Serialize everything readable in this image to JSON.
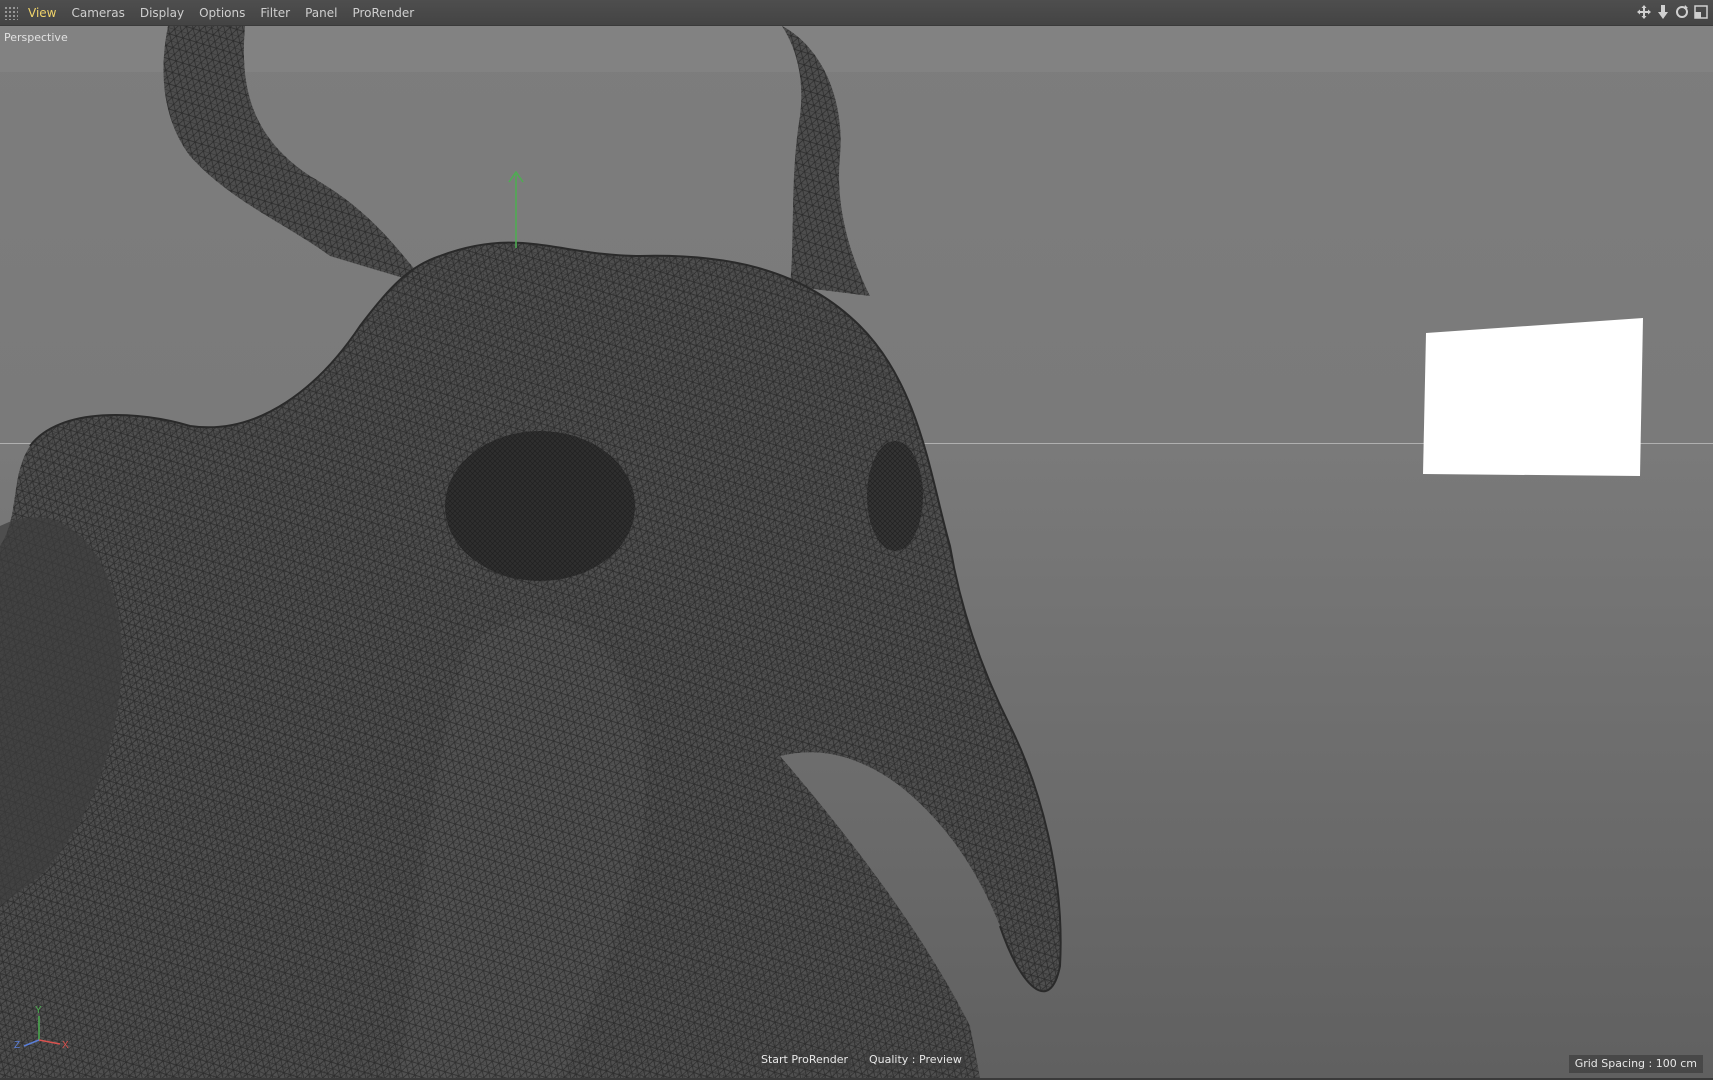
{
  "menubar": {
    "items": [
      {
        "label": "View",
        "active": true
      },
      {
        "label": "Cameras"
      },
      {
        "label": "Display"
      },
      {
        "label": "Options"
      },
      {
        "label": "Filter"
      },
      {
        "label": "Panel"
      },
      {
        "label": "ProRender"
      }
    ],
    "nav_icons": [
      "move-view-icon",
      "dolly-view-icon",
      "rotate-view-icon",
      "maximize-view-icon"
    ]
  },
  "viewport": {
    "camera_label": "Perspective",
    "axis_gizmo": {
      "y": "Y",
      "z": "Z",
      "x": "X"
    },
    "colors": {
      "y_axis": "#4caf50",
      "x_axis": "#d9534f",
      "z_axis": "#5b7fd8",
      "active_menu": "#f0d36a"
    }
  },
  "hud": {
    "start_button": "Start ProRender",
    "quality_button": "Quality : Preview",
    "grid_spacing": "Grid Spacing : 100 cm"
  }
}
